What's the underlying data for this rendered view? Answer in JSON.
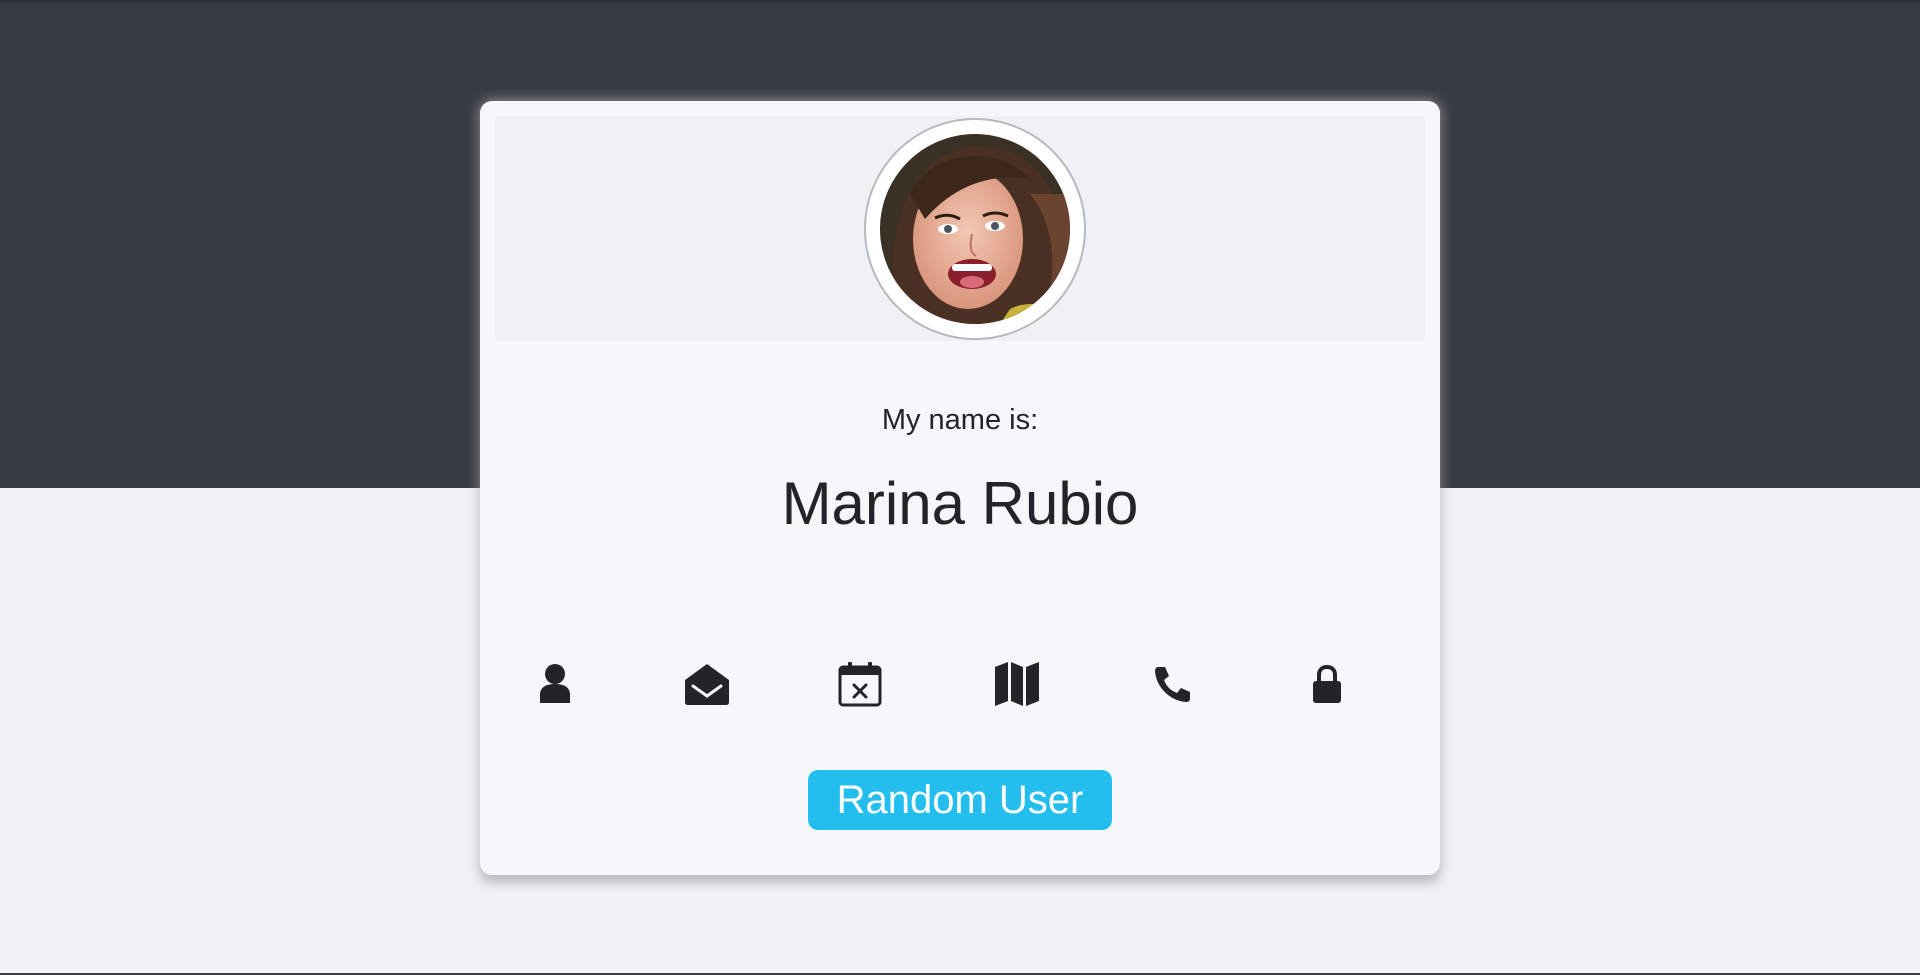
{
  "profile": {
    "intro_label": "My name is:",
    "name": "Marina Rubio"
  },
  "icons": [
    {
      "name": "user-icon"
    },
    {
      "name": "envelope-open-icon"
    },
    {
      "name": "calendar-x-icon"
    },
    {
      "name": "map-icon"
    },
    {
      "name": "phone-icon"
    },
    {
      "name": "lock-icon"
    }
  ],
  "actions": {
    "random_user_label": "Random User"
  },
  "colors": {
    "top_band": "#373b42",
    "page_background": "#f0f3f5",
    "card_background": "#f5f7f9",
    "button": "#23bdee",
    "text": "#212529"
  }
}
